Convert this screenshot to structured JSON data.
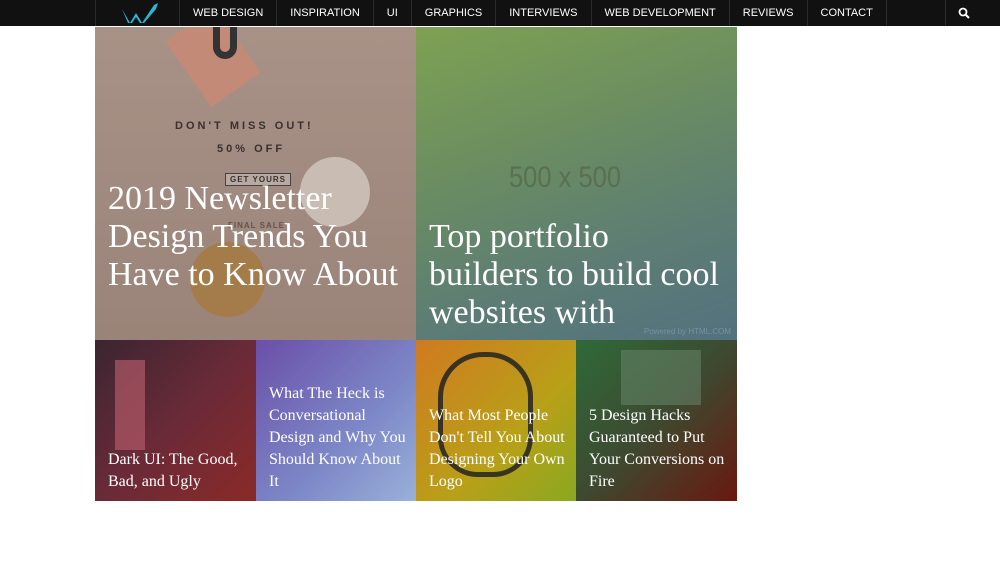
{
  "nav": {
    "items": [
      "WEB DESIGN",
      "INSPIRATION",
      "UI",
      "GRAPHICS",
      "INTERVIEWS",
      "WEB DEVELOPMENT",
      "REVIEWS",
      "CONTACT"
    ],
    "logo_icon": "w-logo",
    "search_icon": "search-icon"
  },
  "featured": [
    {
      "title": "2019 Newsletter Design Trends You Have to Know About",
      "image_text": {
        "line1": "DON'T MISS OUT!",
        "line2": "50% OFF",
        "button": "GET YOURS",
        "sale": "FINAL SALE"
      }
    },
    {
      "title": "Top portfolio builders to build cool websites with",
      "image_text": {
        "placeholder": "500 x 500",
        "credit": "Powered by HTML.COM"
      }
    }
  ],
  "posts": [
    {
      "title": "Dark UI: The Good, Bad, and Ugly"
    },
    {
      "title": "What The Heck is Conversational Design and Why You Should Know About It"
    },
    {
      "title": "What Most People Don't Tell You About Designing Your Own Logo"
    },
    {
      "title": "5 Design Hacks Guaranteed to Put Your Conversions on Fire"
    }
  ],
  "colors": {
    "nav_bg": "#111111",
    "logo": "#29b6d8"
  }
}
